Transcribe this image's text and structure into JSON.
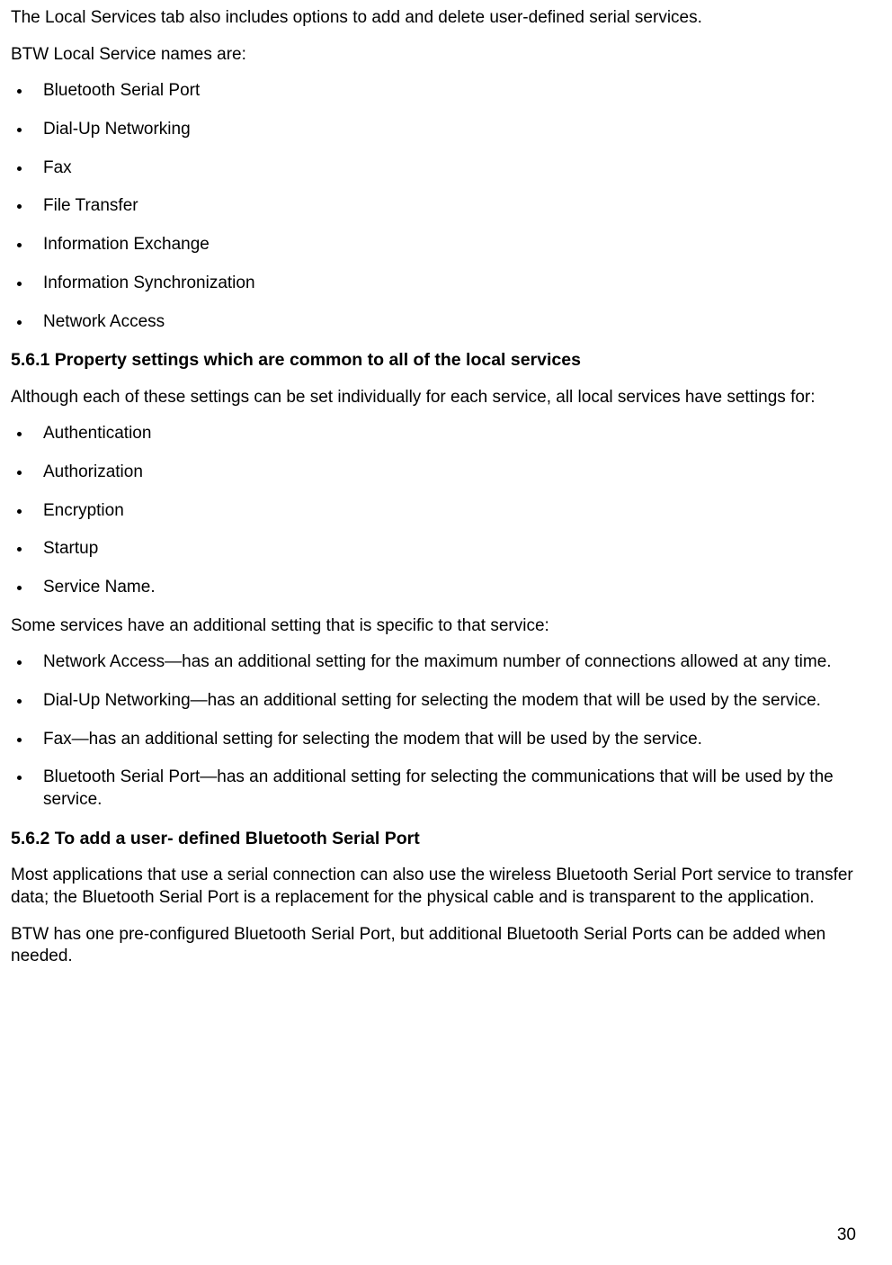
{
  "para1": "The Local Services tab also includes options to add and delete user-defined serial services.",
  "para2": "BTW Local Service names are:",
  "list1": {
    "i0": "Bluetooth Serial Port",
    "i1": "Dial-Up Networking",
    "i2": "Fax",
    "i3": "File Transfer",
    "i4": "Information Exchange",
    "i5": "Information Synchronization",
    "i6": "Network Access"
  },
  "heading1": "5.6.1 Property settings which are common to all of the local services",
  "para3": "Although each of these settings can be set individually for each service, all local services have settings for:",
  "list2": {
    "i0": "Authentication",
    "i1": "Authorization",
    "i2": "Encryption",
    "i3": "Startup",
    "i4": "Service Name."
  },
  "para4": "Some services have an additional setting that is specific to that service:",
  "list3": {
    "i0": "Network Access—has an additional setting for the maximum number of connections allowed at any time.",
    "i1": "Dial-Up Networking—has an additional setting for selecting the modem that will be used by the service.",
    "i2": "Fax—has an additional setting for selecting the modem that will be used by the service.",
    "i3": "Bluetooth Serial Port—has an additional setting for selecting the communications that will be used by the service."
  },
  "heading2": "5.6.2 To add a user- defined Bluetooth Serial Port",
  "para5": "Most applications that use a serial connection can also use the wireless Bluetooth Serial Port service to transfer data; the Bluetooth Serial Port is a replacement for the physical cable and is transparent to the application.",
  "para6": "BTW has one pre-configured Bluetooth Serial Port, but additional Bluetooth Serial Ports can be added when needed.",
  "pageNumber": "30"
}
